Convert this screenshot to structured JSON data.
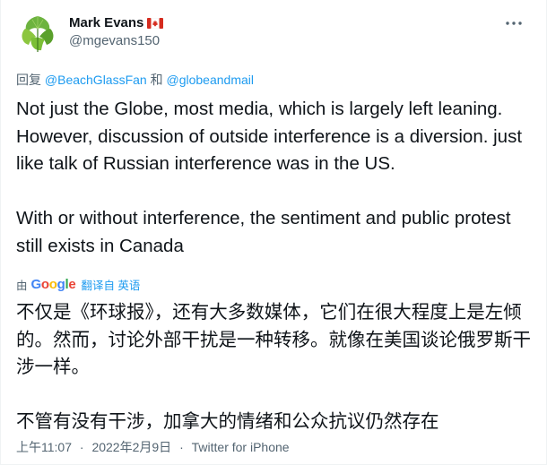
{
  "author": {
    "display_name": "Mark Evans",
    "handle": "@mgevans150",
    "flag_icon": "canada-flag-icon"
  },
  "reply": {
    "prefix": "回复",
    "mention_1": "@BeachGlassFan",
    "conjunction": "和",
    "mention_2": "@globeandmail"
  },
  "tweet": {
    "en_paragraph_1": "Not just the Globe, most media, which is largely left leaning. However, discussion of outside interference is a diversion.  just like talk of Russian interference was in the US.",
    "en_paragraph_2": "With or without interference, the sentiment and public protest still exists in Canada",
    "zh_paragraph_1": "不仅是《环球报》，还有大多数媒体，它们在很大程度上是左倾的。然而，讨论外部干扰是一种转移。就像在美国谈论俄罗斯干涉一样。",
    "zh_paragraph_2": "不管有没有干涉，加拿大的情绪和公众抗议仍然存在"
  },
  "translation": {
    "by_label": "由",
    "provider": "Google",
    "provider_letters": [
      "G",
      "o",
      "o",
      "g",
      "l",
      "e"
    ],
    "action_label": "翻译自 英语"
  },
  "meta": {
    "time": "上午11:07",
    "separator": "·",
    "date": "2022年2月9日",
    "source": "Twitter for iPhone"
  },
  "colors": {
    "text": "#0f1419",
    "secondary": "#536471",
    "link": "#1d9bf0",
    "flag_red": "#d52b1e",
    "avatar_green": "#6db33f"
  },
  "icons": {
    "more": "more-options-icon",
    "avatar": "ginkgo-leaf-avatar"
  }
}
